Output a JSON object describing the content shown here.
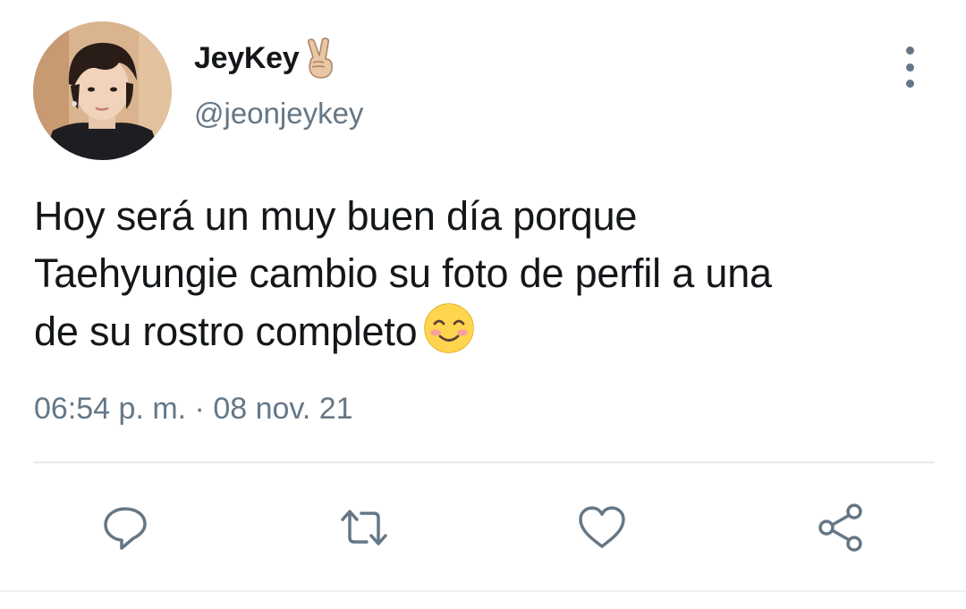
{
  "user": {
    "display_name": "JeyKey",
    "handle": "@jeonjeykey",
    "name_emoji": "victory-hand-emoji"
  },
  "tweet": {
    "lines": [
      "Hoy será un muy buen día porque",
      "Taehyungie cambio su foto de perfil a una",
      "de su rostro completo"
    ],
    "trailing_emoji": "smiling-face-emoji",
    "timestamp": "06:54 p. m. · 08 nov. 21"
  },
  "actions": {
    "icons": [
      "reply-icon",
      "retweet-icon",
      "like-icon",
      "share-icon"
    ]
  },
  "colors": {
    "text": "#14171a",
    "secondary": "#657786",
    "icon": "#657786",
    "divider": "#e6ecf0"
  }
}
